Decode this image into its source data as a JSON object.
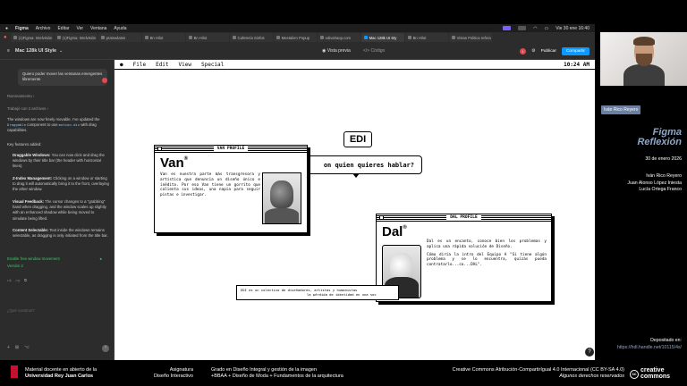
{
  "mac_menubar": {
    "app": "Figma",
    "menus": [
      "Archivo",
      "Editar",
      "Ver",
      "Ventana",
      "Ayuda"
    ],
    "datetime": "Vie 30 ene 16:40"
  },
  "tabs": [
    {
      "label": "(1)Figma: Intelvisión"
    },
    {
      "label": "(1)Figma: Intelvisión"
    },
    {
      "label": "praisedatos"
    },
    {
      "label": "Bn Hilot"
    },
    {
      "label": "Bn Hilot"
    },
    {
      "label": "Cafetería Sinfos"
    },
    {
      "label": "Meetalien Popup"
    },
    {
      "label": "edivalraop.com"
    },
    {
      "label": "Mac 128k UI Sty",
      "active": true
    },
    {
      "label": "Bn Hilot"
    },
    {
      "label": "Vistas Politica refera"
    }
  ],
  "toolbar": {
    "project_title": "Mac 128k UI Style",
    "preview_label": "Vista previa",
    "code_label": "Código",
    "avatar_initial": "I",
    "publish_label": "Publicar",
    "share_label": "Compartir"
  },
  "chat": {
    "user_message": "Quiero poder mover las ventanas emergentes libremente",
    "reasoning_label": "Razonamiento",
    "files_label": "Trabajó con 2 archivos",
    "intro_text_1": "The windows are now freely movable. I've updated the",
    "intro_code_1": "Draggable",
    "intro_text_2": "component to use",
    "intro_code_2": "motion.div",
    "intro_text_3": "with drag capabilities.",
    "features_title": "Key features added:",
    "features": [
      {
        "title": "Draggable Windows:",
        "text": "You can now click and drag the windows by their title bar (the header with horizontal lines)."
      },
      {
        "title": "Z-Index Management:",
        "text": "Clicking on a window or starting to drag it will automatically bring it to the front, overlaying the other window."
      },
      {
        "title": "Visual Feedback:",
        "text": "The cursor changes to a \"grabbing\" hand when dragging, and the window scales up slightly with an enhanced shadow while being moved to simulate being lifted."
      },
      {
        "title": "Content Selectable:",
        "text": "Text inside the windows remains selectable, as dragging is only initiated from the title bar."
      }
    ],
    "persist_link": "Enable free window movement",
    "version_label": "Versión 2",
    "input_placeholder": "¿Qué construir?"
  },
  "canvas": {
    "menu": [
      "File",
      "Edit",
      "View",
      "Special"
    ],
    "clock": "10:24 AM",
    "logo_text": "EDI",
    "speech_text": "on quien quieres hablar?",
    "van": {
      "title": "VAN PROFILE",
      "name": "Van",
      "mark": "®",
      "bio": "Van es nuestra parte más transgresora y artística que denuncia un diseño único e inédito. Por eso Van tiene un gorrito que calienta sus ideas, una napia para seguir pistas e investigar."
    },
    "dal": {
      "title": "DAL PROFILE",
      "name": "Dal",
      "mark": "®",
      "bio_1": "Dal es un encanto, conoce bien los problemas y aplica una rápida solución de Diseño.",
      "bio_2": "Cómo diría la intro del Equipo A \"Si tiene algún problema y se lo encuentra, quizás pueda contratarlo...co...DAL\"."
    },
    "footer_line_1": "EDI es un colectivo de diseñadores, artistas y humanistas",
    "footer_line_2": "la pérdida de identidad en una soc"
  },
  "presenter": {
    "name_tag": "Iván Rico Reyero",
    "brand_1": "Figma",
    "brand_2": "Reflexión",
    "date": "30 de enero 2026",
    "authors": [
      "Iván Rico Reyero",
      "Juan Alonso López Iniesta",
      "Lucía Ortega Franco"
    ],
    "deposit_label": "Depositado en:",
    "deposit_link": "https://hdl.handle.net/10115/4s/"
  },
  "bottombar": {
    "material_line_1": "Material docente en abierto de la",
    "material_line_2": "Universidad Rey Juan Carlos",
    "subject_label": "Asignatura",
    "subject_name": "Diseño Interactivo",
    "degree_line_1": "Grado en Diseño Integral y gestión de la imagen",
    "degree_line_2": "+BBAA + Diseño de Moda + Fundamentos de la arquitectura",
    "license_line_1": "Creative Commons Atribución-CompartirIgual 4.0 Internacional (CC BY-SA 4.0)",
    "license_line_2": "Algunos derechos reservados",
    "cc_word_1": "creative",
    "cc_word_2": "commons"
  },
  "colors": {
    "figma_blue": "#0d99ff",
    "brand_blue": "#8fa7c7",
    "urjc_red": "#c8102e"
  }
}
